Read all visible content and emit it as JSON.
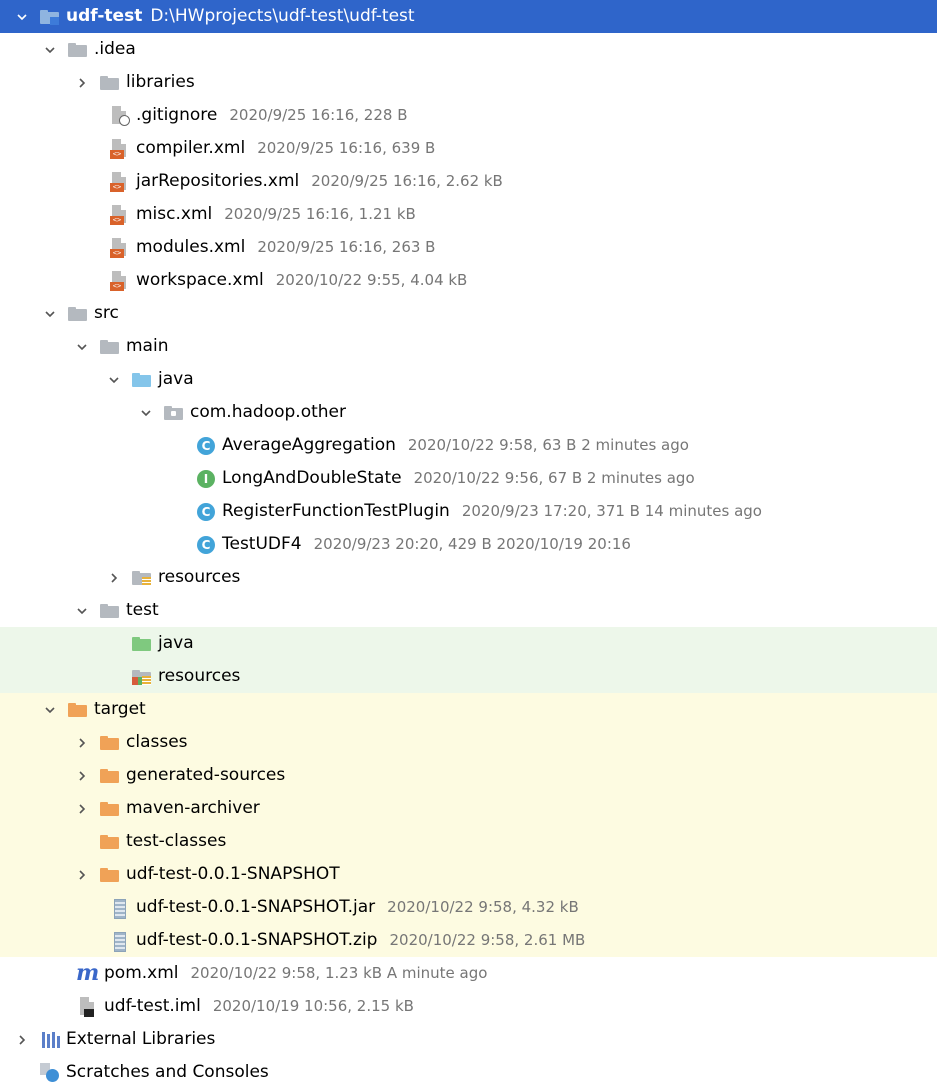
{
  "project": {
    "name": "udf-test",
    "path": "D:\\HWprojects\\udf-test\\udf-test"
  },
  "tree": {
    "idea": {
      "label": ".idea"
    },
    "libraries": {
      "label": "libraries"
    },
    "gitignore": {
      "label": ".gitignore",
      "meta": "2020/9/25 16:16, 228 B"
    },
    "compiler": {
      "label": "compiler.xml",
      "meta": "2020/9/25 16:16, 639 B"
    },
    "jarRepositories": {
      "label": "jarRepositories.xml",
      "meta": "2020/9/25 16:16, 2.62 kB"
    },
    "misc": {
      "label": "misc.xml",
      "meta": "2020/9/25 16:16, 1.21 kB"
    },
    "modules": {
      "label": "modules.xml",
      "meta": "2020/9/25 16:16, 263 B"
    },
    "workspace": {
      "label": "workspace.xml",
      "meta": "2020/10/22 9:55, 4.04 kB"
    },
    "src": {
      "label": "src"
    },
    "main": {
      "label": "main"
    },
    "java_main": {
      "label": "java"
    },
    "package": {
      "label": "com.hadoop.other"
    },
    "average": {
      "badge": "C",
      "label": "AverageAggregation",
      "meta": "2020/10/22 9:58, 63 B 2 minutes ago"
    },
    "longdouble": {
      "badge": "I",
      "label": "LongAndDoubleState",
      "meta": "2020/10/22 9:56, 67 B 2 minutes ago"
    },
    "register": {
      "badge": "C",
      "label": "RegisterFunctionTestPlugin",
      "meta": "2020/9/23 17:20, 371 B 14 minutes ago"
    },
    "testudf4": {
      "badge": "C",
      "label": "TestUDF4",
      "meta": "2020/9/23 20:20, 429 B 2020/10/19 20:16"
    },
    "resources_main": {
      "label": "resources"
    },
    "test": {
      "label": "test"
    },
    "java_test": {
      "label": "java"
    },
    "resources_test": {
      "label": "resources"
    },
    "target": {
      "label": "target"
    },
    "classes": {
      "label": "classes"
    },
    "generated": {
      "label": "generated-sources"
    },
    "maven_archiver": {
      "label": "maven-archiver"
    },
    "test_classes": {
      "label": "test-classes"
    },
    "snapshot_dir": {
      "label": "udf-test-0.0.1-SNAPSHOT"
    },
    "snapshot_jar": {
      "label": "udf-test-0.0.1-SNAPSHOT.jar",
      "meta": "2020/10/22 9:58, 4.32 kB"
    },
    "snapshot_zip": {
      "label": "udf-test-0.0.1-SNAPSHOT.zip",
      "meta": "2020/10/22 9:58, 2.61 MB"
    },
    "pom": {
      "icon_text": "m",
      "label": "pom.xml",
      "meta": "2020/10/22 9:58, 1.23 kB A minute ago"
    },
    "iml": {
      "label": "udf-test.iml",
      "meta": "2020/10/19 10:56, 2.15 kB"
    },
    "external_libraries": {
      "label": "External Libraries"
    },
    "scratches": {
      "label": "Scratches and Consoles"
    }
  },
  "colors": {
    "selection": "#2f65ca",
    "folder_gray": "#b4b9bf",
    "folder_source": "#84c5ea",
    "folder_test": "#7fc97f",
    "folder_excluded": "#f0a257",
    "class_badge": "#42a4d9",
    "interface_badge": "#5bb262",
    "xml_badge": "#d9622a"
  }
}
